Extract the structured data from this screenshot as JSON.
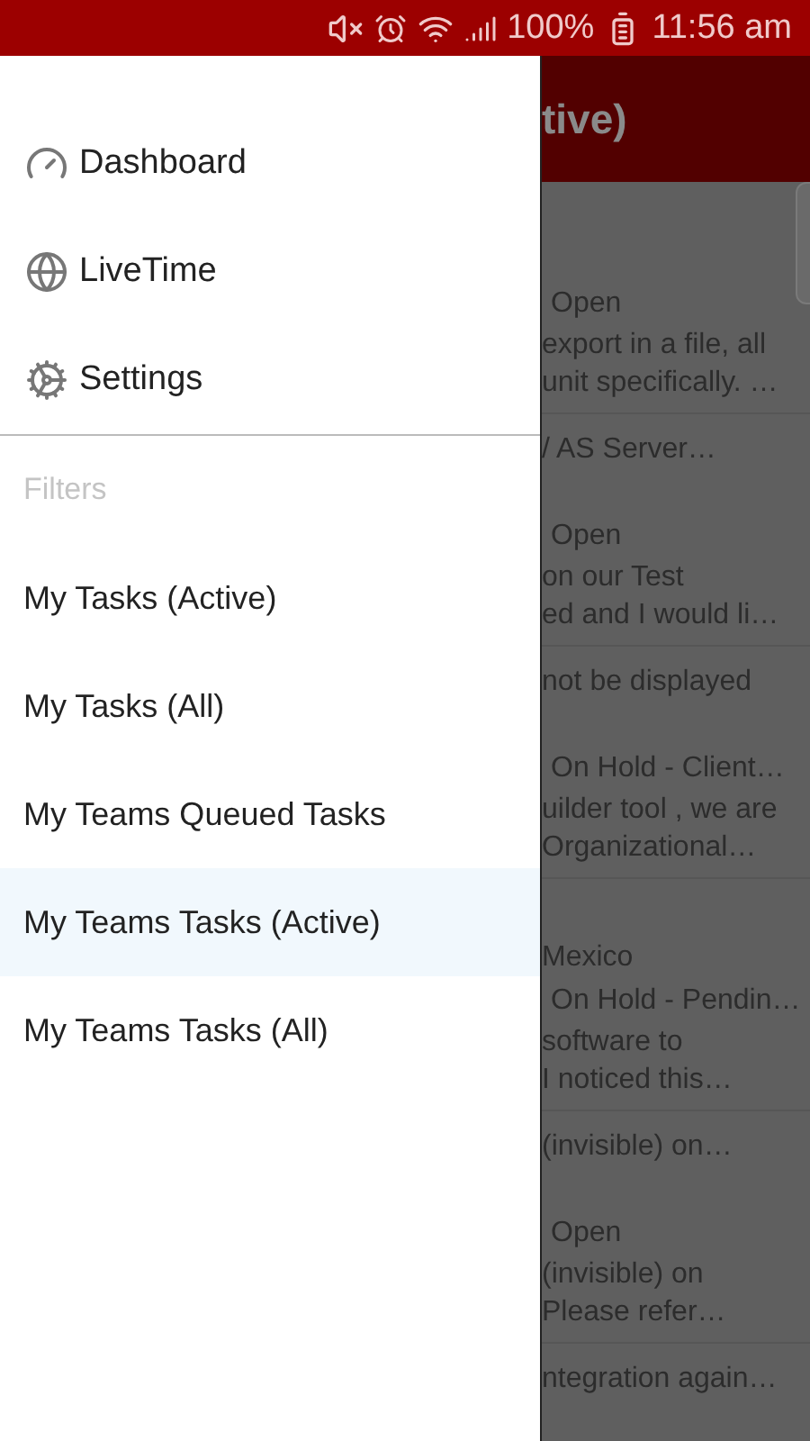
{
  "status_bar": {
    "battery_text": "100%",
    "time": "11:56 am"
  },
  "app_bar": {
    "title": "tive)"
  },
  "list_rows": [
    {
      "status": "Open",
      "snippet": [
        "export in a file, all",
        "unit specifically.  …"
      ]
    },
    {
      "heading": "/ AS Server…",
      "status": "Open",
      "snippet": [
        "on our Test",
        "ed and I would li…"
      ]
    },
    {
      "heading": "not be displayed",
      "status": "On Hold - Client…",
      "snippet": [
        "uilder tool , we are",
        "Organizational…"
      ]
    },
    {
      "subheading": "Mexico",
      "status": "On Hold - Pendin…",
      "snippet": [
        "software to",
        "I noticed this…"
      ]
    },
    {
      "heading": "(invisible) on…",
      "status": "Open",
      "snippet": [
        "(invisible) on",
        "Please refer…"
      ]
    },
    {
      "heading": "ntegration again…"
    }
  ],
  "drawer": {
    "nav_items": [
      {
        "kind": "dashboard",
        "label": "Dashboard"
      },
      {
        "kind": "globe",
        "label": "LiveTime"
      },
      {
        "kind": "settings",
        "label": "Settings"
      }
    ],
    "filters_header": "Filters",
    "filters": [
      {
        "label": "My Tasks (Active)",
        "selected": false
      },
      {
        "label": "My Tasks (All)",
        "selected": false
      },
      {
        "label": "My Teams Queued Tasks",
        "selected": false
      },
      {
        "label": "My Teams Tasks (Active)",
        "selected": true
      },
      {
        "label": "My Teams Tasks (All)",
        "selected": false
      }
    ]
  }
}
